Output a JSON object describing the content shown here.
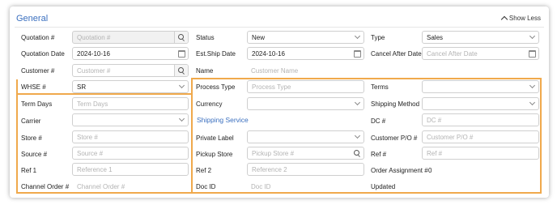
{
  "section": {
    "title": "General",
    "toggle_label": "Show Less"
  },
  "fields": {
    "quotation_no": {
      "label": "Quotation #",
      "placeholder": "Quotation #"
    },
    "status": {
      "label": "Status",
      "value": "New"
    },
    "type": {
      "label": "Type",
      "value": "Sales"
    },
    "quotation_date": {
      "label": "Quotation Date",
      "value": "2024-10-16"
    },
    "est_ship_date": {
      "label": "Est.Ship Date",
      "value": "2024-10-16"
    },
    "cancel_after_date": {
      "label": "Cancel After Date",
      "placeholder": "Cancel After Date"
    },
    "customer_no": {
      "label": "Customer #",
      "placeholder": "Customer #"
    },
    "name": {
      "label": "Name",
      "placeholder": "Customer Name"
    },
    "whse": {
      "label": "WHSE #",
      "value": "SR"
    },
    "process_type": {
      "label": "Process Type",
      "placeholder": "Process Type"
    },
    "terms": {
      "label": "Terms",
      "value": ""
    },
    "term_days": {
      "label": "Term Days",
      "placeholder": "Term Days"
    },
    "currency": {
      "label": "Currency",
      "value": ""
    },
    "shipping_method": {
      "label": "Shipping Method",
      "value": ""
    },
    "carrier": {
      "label": "Carrier",
      "value": ""
    },
    "shipping_service": {
      "label": "Shipping Service"
    },
    "dc_no": {
      "label": "DC #",
      "placeholder": "DC #"
    },
    "store_no": {
      "label": "Store #",
      "placeholder": "Store #"
    },
    "private_label": {
      "label": "Private Label",
      "value": ""
    },
    "customer_po": {
      "label": "Customer P/O #",
      "placeholder": "Customer P/O #"
    },
    "source_no": {
      "label": "Source #",
      "placeholder": "Source #"
    },
    "pickup_store": {
      "label": "Pickup Store",
      "placeholder": "Pickup Store #"
    },
    "ref_no": {
      "label": "Ref #",
      "placeholder": "Ref #"
    },
    "ref1": {
      "label": "Ref 1",
      "placeholder": "Reference 1"
    },
    "ref2": {
      "label": "Ref 2",
      "placeholder": "Reference 2"
    },
    "order_assignment": {
      "label": "Order Assignment #",
      "value": "0"
    },
    "channel_order": {
      "label": "Channel Order #",
      "placeholder": "Channel Order #"
    },
    "doc_id": {
      "label": "Doc ID",
      "placeholder": "Doc ID"
    },
    "updated": {
      "label": "Updated"
    }
  },
  "colors": {
    "accent": "#3a6fbf",
    "highlight": "#f0a94c"
  }
}
